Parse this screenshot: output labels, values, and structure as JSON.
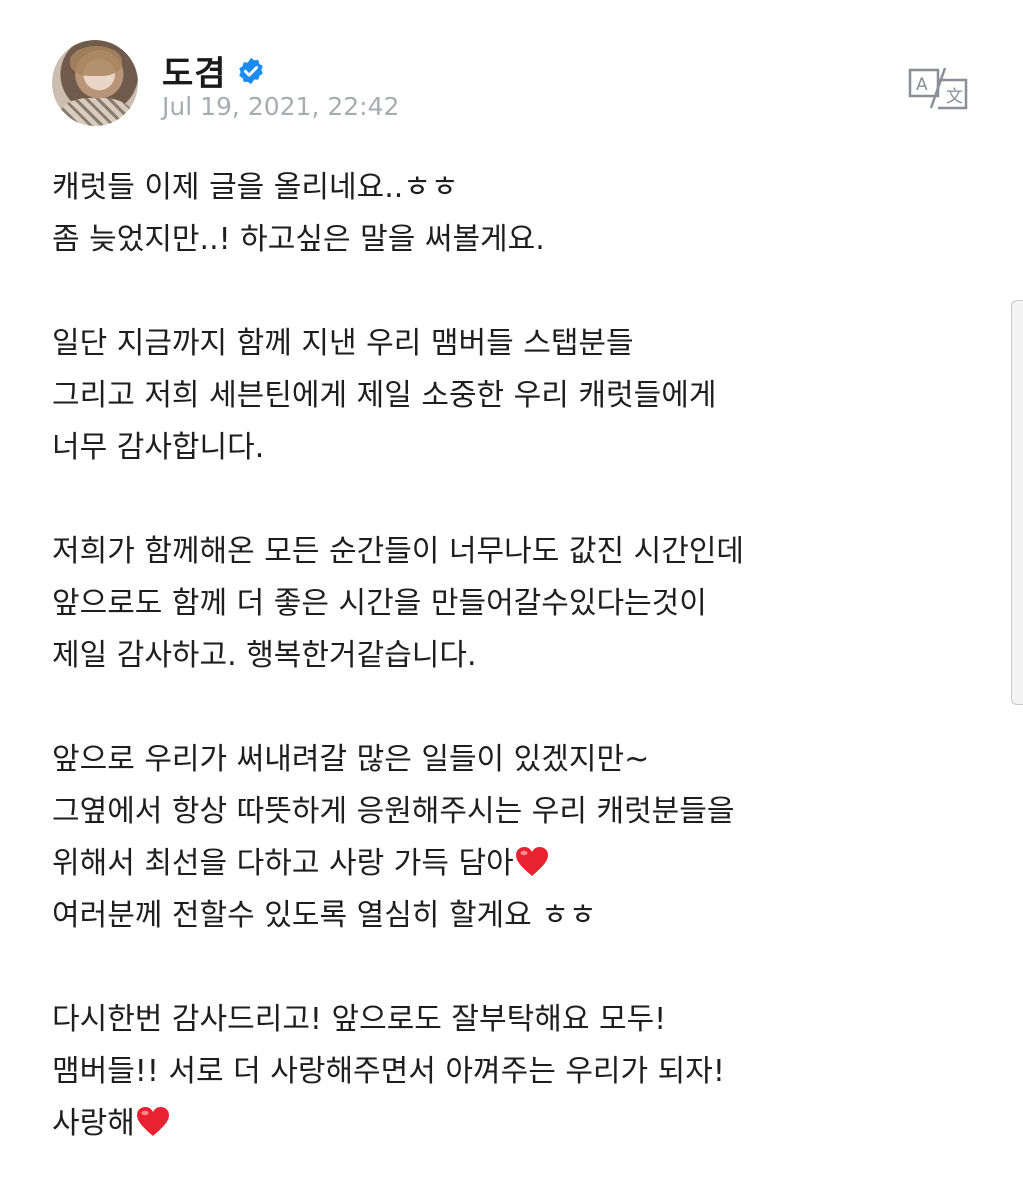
{
  "post": {
    "author": "도겸",
    "verified_icon": "verified-check-icon",
    "timestamp": "Jul 19, 2021, 22:42",
    "translate_icon": "translate-icon"
  },
  "paragraphs": [
    {
      "lines": [
        {
          "text": "캐럿들 이제 글을 올리네요..ㅎㅎ"
        },
        {
          "text": "좀 늦었지만..! 하고싶은 말을 써볼게요."
        }
      ]
    },
    {
      "lines": [
        {
          "text": "일단 지금까지 함께 지낸 우리 맴버들 스탭분들"
        },
        {
          "text": "그리고 저희 세븐틴에게 제일 소중한 우리 캐럿들에게"
        },
        {
          "text": "너무 감사합니다."
        }
      ]
    },
    {
      "lines": [
        {
          "text": "저희가 함께해온 모든 순간들이 너무나도 값진 시간인데"
        },
        {
          "text": "앞으로도 함께 더 좋은 시간을 만들어갈수있다는것이"
        },
        {
          "text": "제일 감사하고. 행복한거같습니다."
        }
      ]
    },
    {
      "lines": [
        {
          "text": "앞으로 우리가 써내려갈 많은 일들이 있겠지만~"
        },
        {
          "text": "그옆에서 항상 따뜻하게 응원해주시는 우리 캐럿분들을"
        },
        {
          "text": "위해서 최선을 다하고 사랑 가득 담아",
          "emoji": "heart-emoji"
        },
        {
          "text": "여러분께 전할수 있도록 열심히 할게요 ㅎㅎ"
        }
      ]
    },
    {
      "lines": [
        {
          "text": "다시한번 감사드리고! 앞으로도 잘부탁해요 모두!"
        },
        {
          "text": "맴버들!! 서로 더 사랑해주면서 아껴주는 우리가 되자!"
        },
        {
          "text": "사랑해",
          "emoji": "heart-emoji"
        }
      ]
    }
  ],
  "colors": {
    "heart": "#e8232f",
    "verified": "#1a8cf0",
    "timestamp": "#a8acb2"
  }
}
